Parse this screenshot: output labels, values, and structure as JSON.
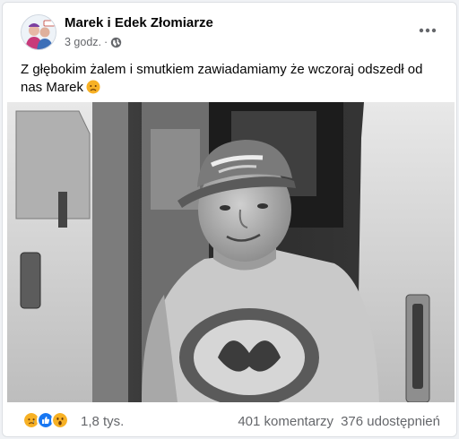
{
  "post": {
    "author": "Marek i Edek Złomiarze",
    "time": "3 godz.",
    "dot": "·",
    "text": "Z głębokim żalem i smutkiem zawiadamiamy że wczoraj odszedł od nas  Marek",
    "text_emoji": "sad-face-icon"
  },
  "footer": {
    "reactions": [
      "sad-reaction-icon",
      "like-reaction-icon",
      "wow-reaction-icon"
    ],
    "reaction_count": "1,8 tys.",
    "comments": "401 komentarzy",
    "shares": "376 udostępnień"
  },
  "colors": {
    "card": "#ffffff",
    "secondary_text": "#65676b",
    "like_blue": "#1877f2",
    "reaction_yellow": "#f7b125"
  }
}
